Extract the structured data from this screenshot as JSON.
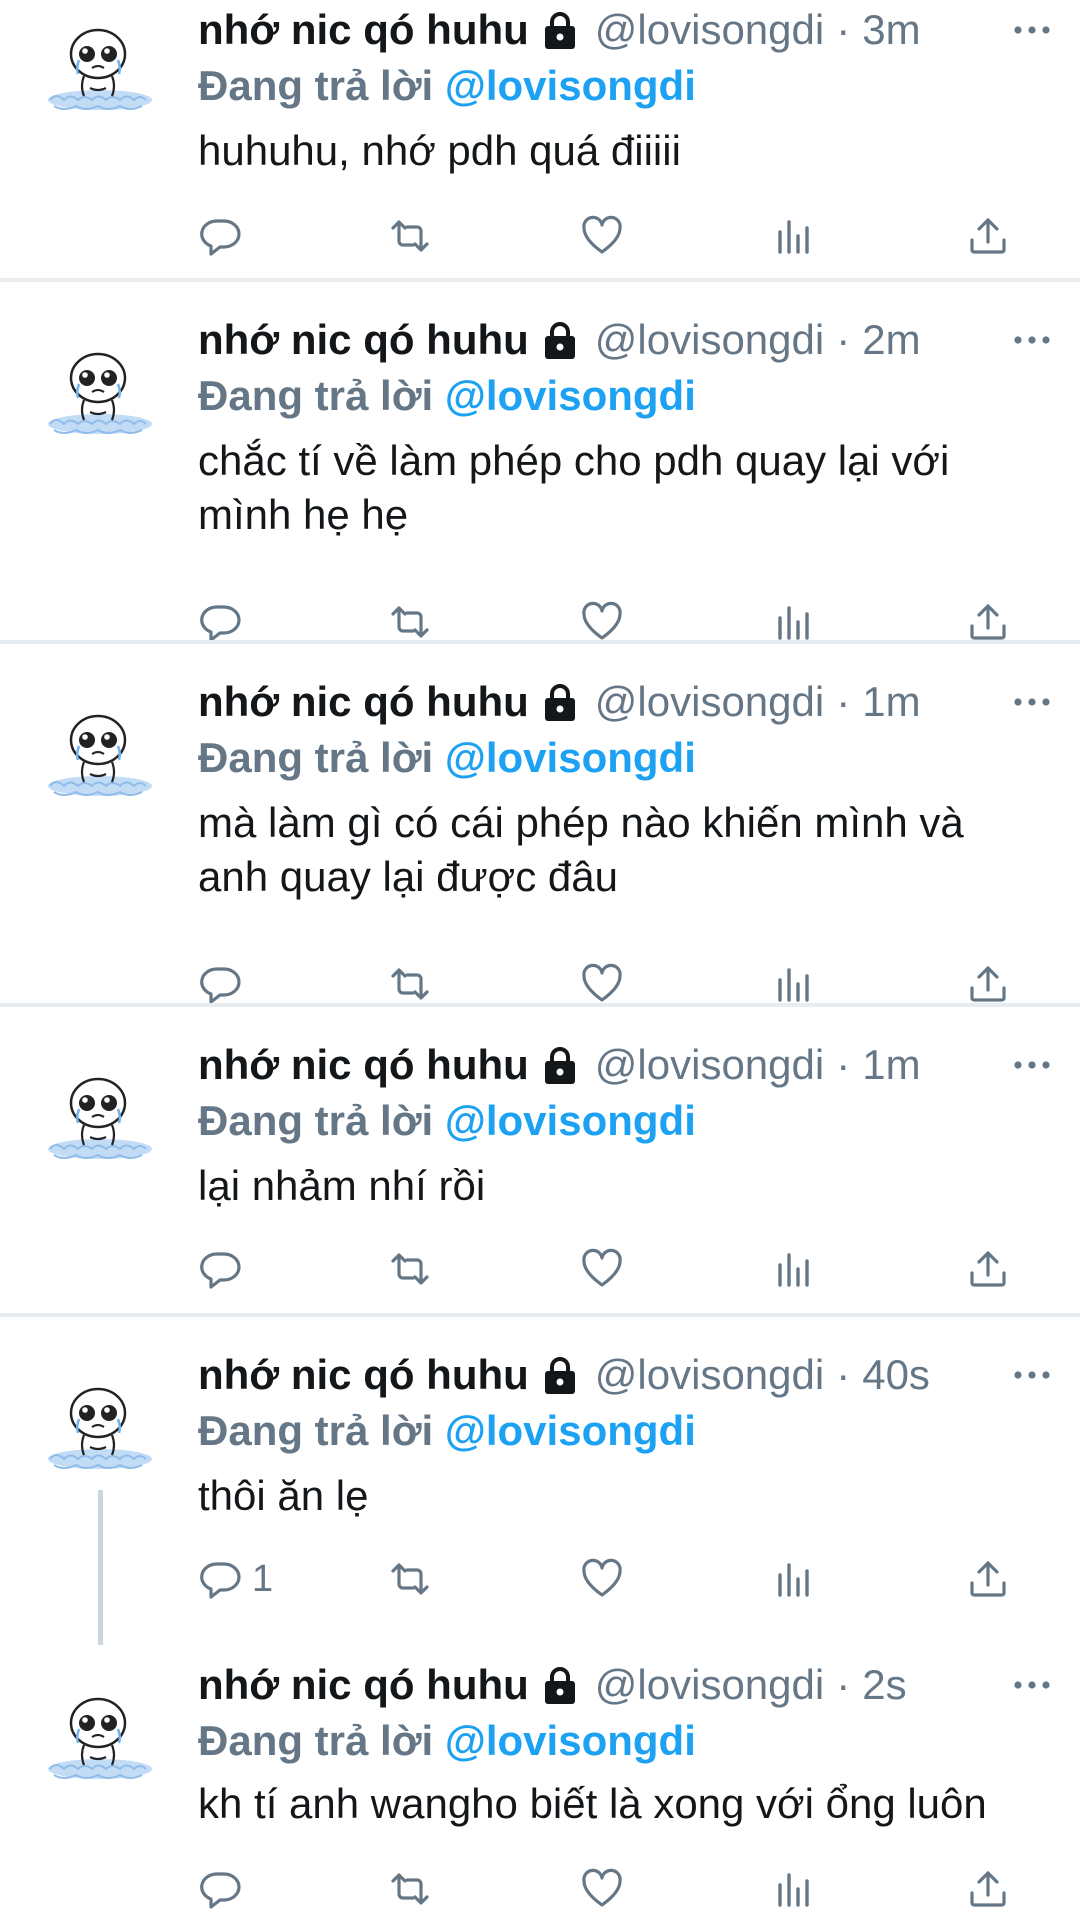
{
  "tweets": [
    {
      "name": "nhớ nic qó huhu",
      "handle": "@lovisongdi",
      "separator": "·",
      "time": "3m",
      "replying_label": "Đang trả lời",
      "replying_to": "@lovisongdi",
      "text": "huhuhu, nhớ pdh quá điiiii",
      "reply_count": ""
    },
    {
      "name": "nhớ nic qó huhu",
      "handle": "@lovisongdi",
      "separator": "·",
      "time": "2m",
      "replying_label": "Đang trả lời",
      "replying_to": "@lovisongdi",
      "text": "chắc tí về làm phép cho pdh quay lại với mình hẹ hẹ",
      "reply_count": ""
    },
    {
      "name": "nhớ nic qó huhu",
      "handle": "@lovisongdi",
      "separator": "·",
      "time": "1m",
      "replying_label": "Đang trả lời",
      "replying_to": "@lovisongdi",
      "text": "mà làm gì có cái phép nào khiến mình và anh quay lại được đâu",
      "reply_count": ""
    },
    {
      "name": "nhớ nic qó huhu",
      "handle": "@lovisongdi",
      "separator": "·",
      "time": "1m",
      "replying_label": "Đang trả lời",
      "replying_to": "@lovisongdi",
      "text": "lại nhảm nhí rồi",
      "reply_count": ""
    },
    {
      "name": "nhớ nic qó huhu",
      "handle": "@lovisongdi",
      "separator": "·",
      "time": "40s",
      "replying_label": "Đang trả lời",
      "replying_to": "@lovisongdi",
      "text": "thôi ăn lẹ",
      "reply_count": "1"
    },
    {
      "name": "nhớ nic qó huhu",
      "handle": "@lovisongdi",
      "separator": "·",
      "time": "2s",
      "replying_label": "Đang trả lời",
      "replying_to": "@lovisongdi",
      "text": "kh tí anh wangho biết là xong với ổng luôn",
      "reply_count": ""
    }
  ],
  "icons": {
    "avatar": "crying-doodle-avatar",
    "lock": "lock-icon",
    "more": "more-options-icon",
    "reply": "reply-icon",
    "retweet": "retweet-icon",
    "like": "like-icon",
    "analytics": "analytics-icon",
    "share": "share-icon"
  },
  "colors": {
    "link": "#1da1f2",
    "secondary_text": "#657786",
    "divider": "#e6ecf0",
    "text": "#14171a"
  }
}
